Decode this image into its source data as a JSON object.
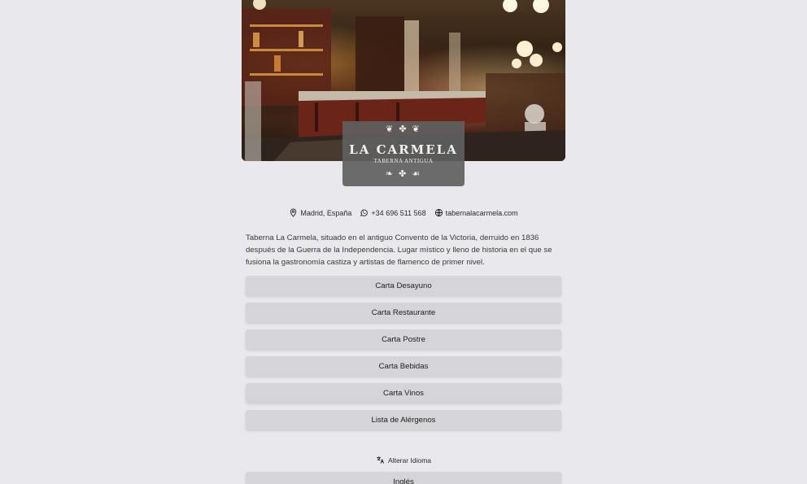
{
  "brand": {
    "name": "LA CARMELA",
    "subtitle": "TABERNA ANTIGUA"
  },
  "contact": {
    "location": "Madrid, España",
    "phone": "+34 696 511 568",
    "website": "tabernalacarmela.com"
  },
  "description": "Taberna La Carmela, situado en el antiguo Convento de la Victoria, derruido en 1836 después de la Guerra de la Independencia. Lugar místico y lleno de historia en el que se fusiona la gastronomía castiza y artistas de flamenco de primer nivel.",
  "menu": {
    "items": [
      "Carta Desayuno",
      "Carta Restaurante",
      "Carta Postre",
      "Carta Bebidas",
      "Carta Vinos",
      "Lista de Alérgenos"
    ]
  },
  "language": {
    "label": "Alterar Idioma",
    "option": "Inglés"
  },
  "colors": {
    "background": "#e9e8ed",
    "button": "#d5d4d9",
    "logo_box": "#5f5f5f"
  }
}
